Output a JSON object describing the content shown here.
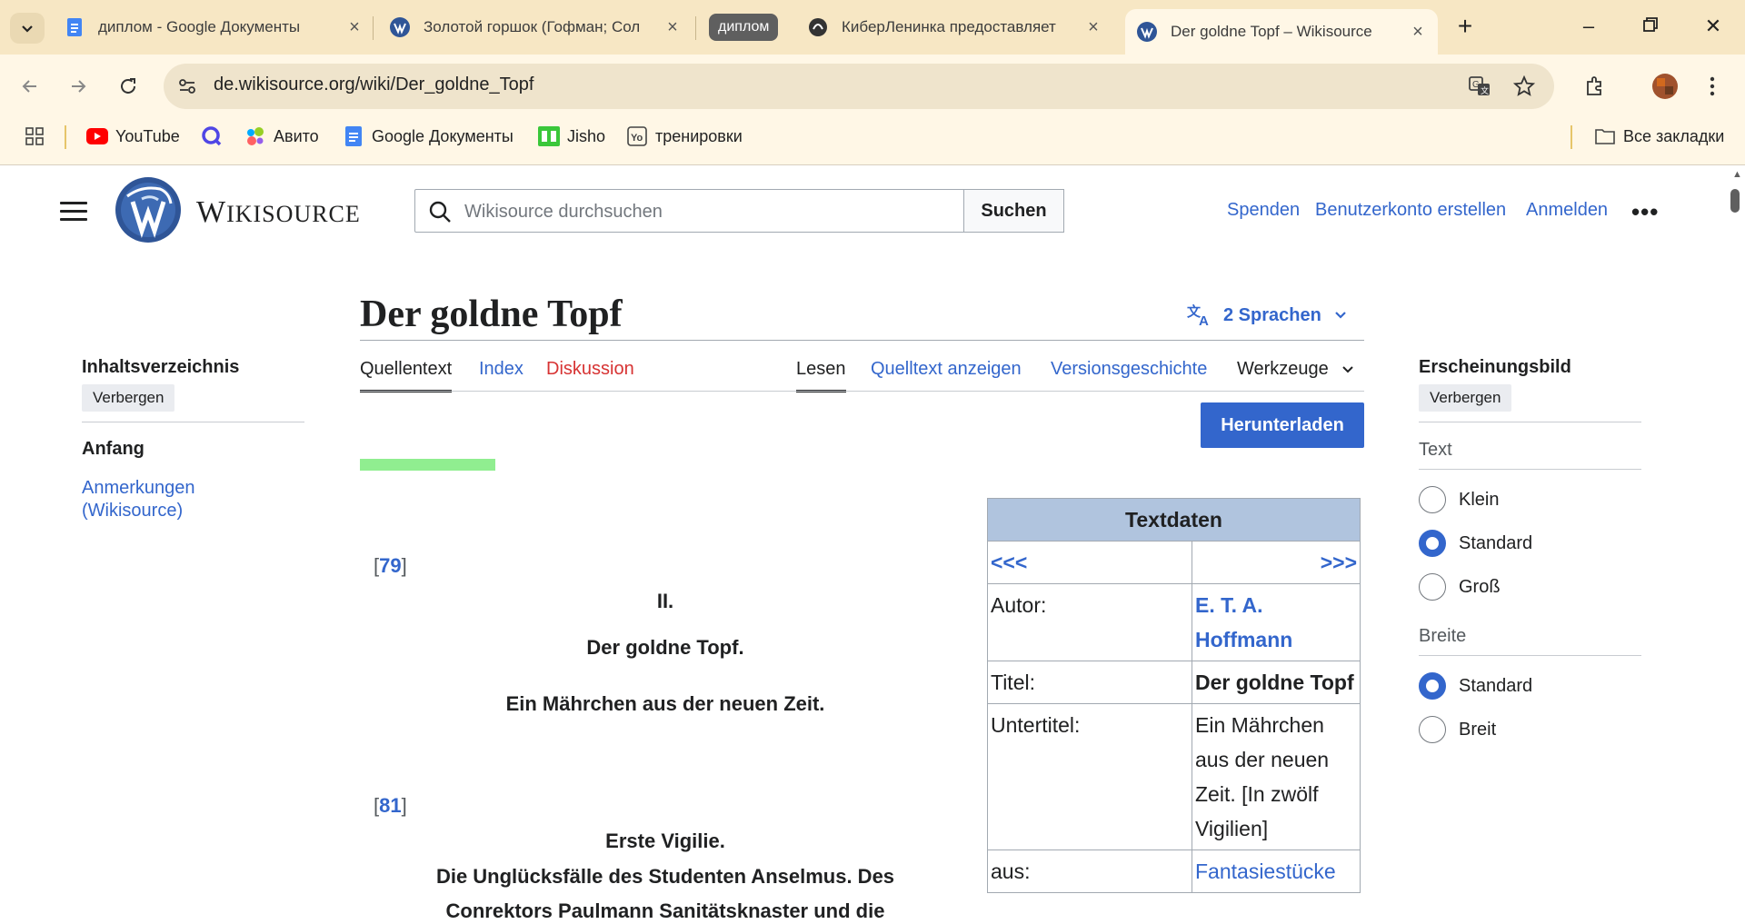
{
  "browser": {
    "tabs": [
      {
        "title": "диплом - Google Документы",
        "icon": "google-docs-icon"
      },
      {
        "title": "Золотой горшок (Гофман; Сол",
        "icon": "wikisource-icon"
      },
      {
        "title": "КиберЛенинка предоставляет",
        "icon": "cyberleninka-icon"
      },
      {
        "title": "Der goldne Topf – Wikisource",
        "icon": "wikisource-icon",
        "active": true
      }
    ],
    "tab_group_label": "диплом",
    "url": "de.wikisource.org/wiki/Der_goldne_Topf",
    "bookmarks": [
      {
        "label": "YouTube",
        "icon": "youtube-icon"
      },
      {
        "label": "",
        "icon": "q-icon"
      },
      {
        "label": "Авито",
        "icon": "avito-icon"
      },
      {
        "label": "Google Документы",
        "icon": "google-docs-icon"
      },
      {
        "label": "Jisho",
        "icon": "jisho-icon"
      },
      {
        "label": "тренировки",
        "icon": "yo-icon"
      }
    ],
    "all_bookmarks_label": "Все закладки",
    "accent_color": "#f7e7c4"
  },
  "site": {
    "wordmark": "Wikisource",
    "search_placeholder": "Wikisource durchsuchen",
    "search_button": "Suchen",
    "header_links": {
      "donate": "Spenden",
      "create_account": "Benutzerkonto erstellen",
      "login": "Anmelden"
    }
  },
  "page": {
    "title": "Der goldne Topf",
    "languages": "2 Sprachen",
    "tabs_left": [
      "Quellentext",
      "Index",
      "Diskussion"
    ],
    "tabs_right": [
      "Lesen",
      "Quelltext anzeigen",
      "Versionsgeschichte",
      "Werkzeuge"
    ],
    "download": "Herunterladen"
  },
  "toc": {
    "heading": "Inhaltsverzeichnis",
    "hide": "Verbergen",
    "items": [
      "Anfang",
      "Anmerkungen (Wikisource)"
    ]
  },
  "appearance": {
    "heading": "Erscheinungsbild",
    "hide": "Verbergen",
    "text_label": "Text",
    "text_options": [
      "Klein",
      "Standard",
      "Groß"
    ],
    "text_selected": "Standard",
    "width_label": "Breite",
    "width_options": [
      "Standard",
      "Breit"
    ],
    "width_selected": "Standard"
  },
  "content": {
    "page_num_1": "79",
    "roman": "II.",
    "title": "Der goldne Topf.",
    "subtitle": "Ein Mährchen aus der neuen Zeit.",
    "page_num_2": "81",
    "vigil_title": "Erste Vigilie.",
    "vigil_line_1": "Die Unglücksfälle des Studenten Anselmus. Des",
    "vigil_line_2": "Conrektors Paulmann Sanitätsknaster und die"
  },
  "textdaten": {
    "header": "Textdaten",
    "prev": "<<<",
    "next": ">>>",
    "rows": [
      {
        "label": "Autor:",
        "value": "E. T. A. Hoffmann"
      },
      {
        "label": "Titel:",
        "value": "Der goldne Topf"
      },
      {
        "label": "Untertitel:",
        "value": "Ein Mährchen aus der neuen Zeit. [In zwölf Vigilien]"
      },
      {
        "label": "aus:",
        "value": "Fantasiestücke"
      }
    ]
  }
}
